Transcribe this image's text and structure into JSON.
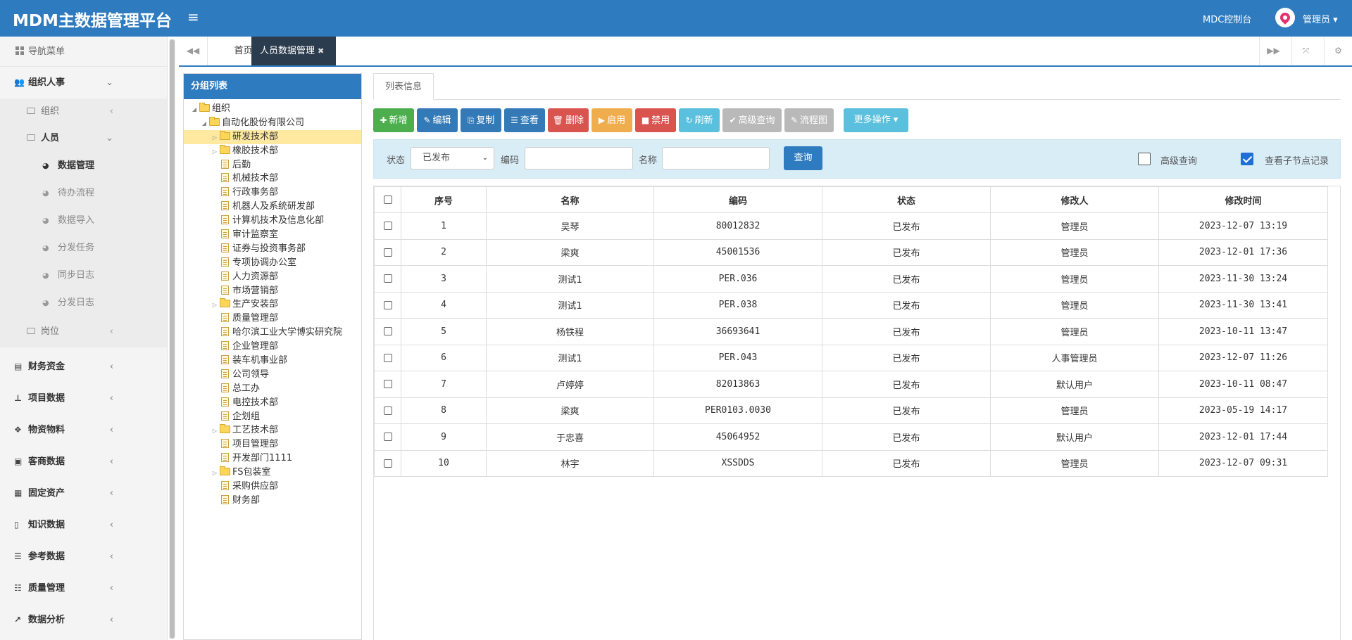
{
  "header": {
    "app_title": "MDM主数据管理平台",
    "menu_toggle": "≡",
    "console_link": "MDC控制台",
    "user_name": "管理员 ▾"
  },
  "sidebar": {
    "header": "导航菜单",
    "groups": [
      {
        "label": "组织人事",
        "icon": "users-icon",
        "glyph": "👥",
        "expanded": true
      },
      {
        "label": "财务资金",
        "icon": "money-icon",
        "glyph": "▤"
      },
      {
        "label": "项目数据",
        "icon": "sitemap-icon",
        "glyph": "⊥"
      },
      {
        "label": "物资物料",
        "icon": "cubes-icon",
        "glyph": "❖"
      },
      {
        "label": "客商数据",
        "icon": "bank-icon",
        "glyph": "▣"
      },
      {
        "label": "固定资产",
        "icon": "building-icon",
        "glyph": "▦"
      },
      {
        "label": "知识数据",
        "icon": "book-icon",
        "glyph": "▯"
      },
      {
        "label": "参考数据",
        "icon": "list-icon",
        "glyph": "☰"
      },
      {
        "label": "质量管理",
        "icon": "list-alt-icon",
        "glyph": "☷"
      },
      {
        "label": "数据分析",
        "icon": "chart-icon",
        "glyph": "↗"
      }
    ],
    "subs": {
      "org": "组织",
      "person": "人员",
      "post": "岗位"
    },
    "leaves": [
      "数据管理",
      "待办流程",
      "数据导入",
      "分发任务",
      "同步日志",
      "分发日志"
    ]
  },
  "tabs": {
    "home": "首页",
    "current": "人员数据管理",
    "close": "✖"
  },
  "tree_panel": {
    "title": "分组列表",
    "nodes": [
      {
        "label": "组织",
        "level": 0,
        "type": "folder",
        "toggle": "◢"
      },
      {
        "label": "自动化股份有限公司",
        "level": 1,
        "type": "folder",
        "toggle": "◢"
      },
      {
        "label": "研发技术部",
        "level": 2,
        "type": "folder",
        "toggle": "▷",
        "selected": true
      },
      {
        "label": "橡胶技术部",
        "level": 2,
        "type": "folder",
        "toggle": "▷"
      },
      {
        "label": "后勤",
        "level": 2,
        "type": "doc"
      },
      {
        "label": "机械技术部",
        "level": 2,
        "type": "doc"
      },
      {
        "label": "行政事务部",
        "level": 2,
        "type": "doc"
      },
      {
        "label": "机器人及系统研发部",
        "level": 2,
        "type": "doc"
      },
      {
        "label": "计算机技术及信息化部",
        "level": 2,
        "type": "doc"
      },
      {
        "label": "审计监察室",
        "level": 2,
        "type": "doc"
      },
      {
        "label": "证券与投资事务部",
        "level": 2,
        "type": "doc"
      },
      {
        "label": "专项协调办公室",
        "level": 2,
        "type": "doc"
      },
      {
        "label": "人力资源部",
        "level": 2,
        "type": "doc"
      },
      {
        "label": "市场营销部",
        "level": 2,
        "type": "doc"
      },
      {
        "label": "生产安装部",
        "level": 2,
        "type": "folder",
        "toggle": "▷"
      },
      {
        "label": "质量管理部",
        "level": 2,
        "type": "doc"
      },
      {
        "label": "哈尔滨工业大学博实研究院",
        "level": 2,
        "type": "doc"
      },
      {
        "label": "企业管理部",
        "level": 2,
        "type": "doc"
      },
      {
        "label": "装车机事业部",
        "level": 2,
        "type": "doc"
      },
      {
        "label": "公司领导",
        "level": 2,
        "type": "doc"
      },
      {
        "label": "总工办",
        "level": 2,
        "type": "doc"
      },
      {
        "label": "电控技术部",
        "level": 2,
        "type": "doc"
      },
      {
        "label": "企划组",
        "level": 2,
        "type": "doc"
      },
      {
        "label": "工艺技术部",
        "level": 2,
        "type": "folder",
        "toggle": "▷"
      },
      {
        "label": "项目管理部",
        "level": 2,
        "type": "doc"
      },
      {
        "label": "开发部门1111",
        "level": 2,
        "type": "doc"
      },
      {
        "label": "FS包装室",
        "level": 2,
        "type": "folder",
        "toggle": "▷"
      },
      {
        "label": "采购供应部",
        "level": 2,
        "type": "doc"
      },
      {
        "label": "财务部",
        "level": 2,
        "type": "doc"
      }
    ]
  },
  "main": {
    "tab_label": "列表信息",
    "toolbar": [
      {
        "label": "新增",
        "glyph": "✚",
        "color": "#4cae4c",
        "icon": "plus-icon",
        "name": "add-button"
      },
      {
        "label": "编辑",
        "glyph": "✎",
        "color": "#337ab7",
        "icon": "edit-icon",
        "name": "edit-button"
      },
      {
        "label": "复制",
        "glyph": "⎘",
        "color": "#337ab7",
        "icon": "copy-icon",
        "name": "copy-button"
      },
      {
        "label": "查看",
        "glyph": "☰",
        "color": "#337ab7",
        "icon": "list-icon",
        "name": "view-button"
      },
      {
        "label": "删除",
        "glyph": "🗑",
        "color": "#d9534f",
        "icon": "trash-icon",
        "name": "delete-button"
      },
      {
        "label": "启用",
        "glyph": "▶",
        "color": "#f0ad4e",
        "icon": "play-icon",
        "name": "enable-button"
      },
      {
        "label": "禁用",
        "glyph": "■",
        "color": "#d9534f",
        "icon": "stop-icon",
        "name": "disable-button"
      },
      {
        "label": "刷新",
        "glyph": "↻",
        "color": "#5bc0de",
        "icon": "refresh-icon",
        "name": "refresh-button"
      },
      {
        "label": "高级查询",
        "glyph": "✔",
        "color": "#b9b9b9",
        "icon": "check-icon",
        "name": "advanced-query-button"
      },
      {
        "label": "流程图",
        "glyph": "✎",
        "color": "#b9b9b9",
        "icon": "pencil-icon",
        "name": "flowchart-button"
      },
      {
        "label": "更多操作 ▾",
        "glyph": "",
        "color": "#5bc0de",
        "icon": "",
        "name": "more-actions-button"
      }
    ],
    "search": {
      "status_label": "状态",
      "status_value": "已发布",
      "code_label": "编码",
      "code_value": "",
      "name_label": "名称",
      "name_value": "",
      "query_button": "查询",
      "advanced_label": "高级查询",
      "advanced_checked": false,
      "subnode_label": "查看子节点记录",
      "subnode_checked": true
    },
    "table": {
      "columns": [
        "序号",
        "名称",
        "编码",
        "状态",
        "修改人",
        "修改时间"
      ],
      "rows": [
        [
          "1",
          "吴琴",
          "80012832",
          "已发布",
          "管理员",
          "2023-12-07 13:19"
        ],
        [
          "2",
          "梁爽",
          "45001536",
          "已发布",
          "管理员",
          "2023-12-01 17:36"
        ],
        [
          "3",
          "测试1",
          "PER.036",
          "已发布",
          "管理员",
          "2023-11-30 13:24"
        ],
        [
          "4",
          "测试1",
          "PER.038",
          "已发布",
          "管理员",
          "2023-11-30 13:41"
        ],
        [
          "5",
          "杨铁程",
          "36693641",
          "已发布",
          "管理员",
          "2023-10-11 13:47"
        ],
        [
          "6",
          "测试1",
          "PER.043",
          "已发布",
          "人事管理员",
          "2023-12-07 11:26"
        ],
        [
          "7",
          "卢婷婷",
          "82013863",
          "已发布",
          "默认用户",
          "2023-10-11 08:47"
        ],
        [
          "8",
          "梁爽",
          "PER0103.0030",
          "已发布",
          "管理员",
          "2023-05-19 14:17"
        ],
        [
          "9",
          "于忠喜",
          "45064952",
          "已发布",
          "默认用户",
          "2023-12-01 17:44"
        ],
        [
          "10",
          "林宇",
          "XSSDDS",
          "已发布",
          "管理员",
          "2023-12-07 09:31"
        ]
      ]
    }
  }
}
